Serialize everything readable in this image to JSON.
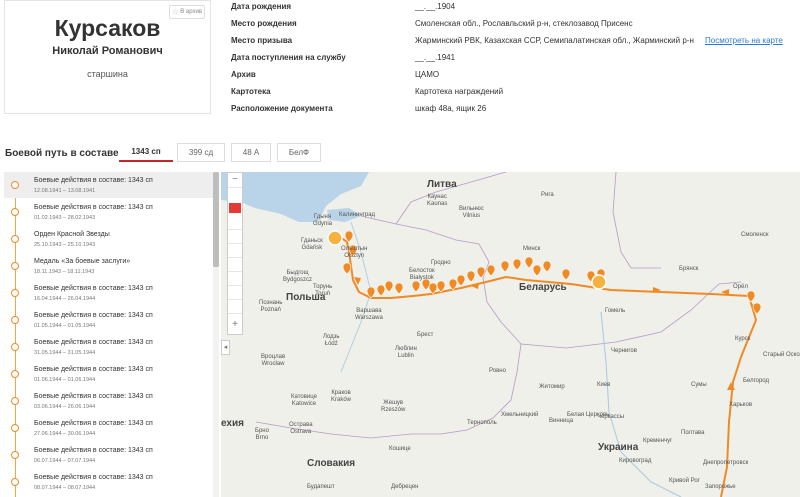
{
  "profile": {
    "surname": "Курсаков",
    "name": "Николай Романович",
    "rank": "старшина",
    "archive_badge": "В архив"
  },
  "info": [
    {
      "label": "Дата рождения",
      "value": "__.__.1904"
    },
    {
      "label": "Место рождения",
      "value": "Смоленская обл., Рославльский р-н, стеклозавод Присенс"
    },
    {
      "label": "Место призыва",
      "value": "Жарминский РВК, Казахская ССР, Семипалатинская обл., Жарминский р-н",
      "link": "Посмотреть на карте"
    },
    {
      "label": "Дата поступления на службу",
      "value": "__.__.1941"
    },
    {
      "label": "Архив",
      "value": "ЦАМО"
    },
    {
      "label": "Картотека",
      "value": "Картотека награждений"
    },
    {
      "label": "Расположение документа",
      "value": "шкаф 48а, ящик 26"
    }
  ],
  "path": {
    "title": "Боевой путь в составе:",
    "tabs": [
      "1343 сп",
      "399 сд",
      "48 А",
      "БелФ"
    ],
    "active_tab": 0
  },
  "timeline": [
    {
      "title": "Боевые действия в составе: 1343 сп",
      "date": "12.08.1941 – 13.08.1941"
    },
    {
      "title": "Боевые действия в составе: 1343 сп",
      "date": "01.02.1943 – 28.02.1943"
    },
    {
      "title": "Орден Красной Звезды",
      "date": "25.10.1943 – 25.10.1943"
    },
    {
      "title": "Медаль «За боевые заслуги»",
      "date": "18.11.1943 – 18.11.1943"
    },
    {
      "title": "Боевые действия в составе: 1343 сп",
      "date": "16.04.1944 – 26.04.1944"
    },
    {
      "title": "Боевые действия в составе: 1343 сп",
      "date": "01.05.1944 – 01.05.1944"
    },
    {
      "title": "Боевые действия в составе: 1343 сп",
      "date": "31.05.1944 – 31.05.1944"
    },
    {
      "title": "Боевые действия в составе: 1343 сп",
      "date": "01.06.1944 – 01.06.1944"
    },
    {
      "title": "Боевые действия в составе: 1343 сп",
      "date": "03.06.1944 – 26.06.1944"
    },
    {
      "title": "Боевые действия в составе: 1343 сп",
      "date": "27.06.1944 – 30.06.1944"
    },
    {
      "title": "Боевые действия в составе: 1343 сп",
      "date": "06.07.1944 – 07.07.1944"
    },
    {
      "title": "Боевые действия в составе: 1343 сп",
      "date": "08.07.1944 – 08.07.1944"
    }
  ],
  "map": {
    "route_color": "#f08a24",
    "zoom_in": "+",
    "zoom_out": "−",
    "collapse": "◂",
    "labels": [
      {
        "text": "Литва",
        "kind": "country"
      },
      {
        "text": "Польша",
        "kind": "country"
      },
      {
        "text": "Беларусь",
        "kind": "country"
      },
      {
        "text": "Украина",
        "kind": "country"
      },
      {
        "text": "Словакия",
        "kind": "country"
      },
      {
        "text": "ехия",
        "kind": "country"
      },
      {
        "text": "Гдыня\nGdynia",
        "kind": "city"
      },
      {
        "text": "Гданьск\nGdańsk",
        "kind": "city"
      },
      {
        "text": "Калининград",
        "kind": "city"
      },
      {
        "text": "Ольштын\nOlsztyn",
        "kind": "city"
      },
      {
        "text": "Быдгощ\nBydgoszcz",
        "kind": "city"
      },
      {
        "text": "Торунь\nToruń",
        "kind": "city"
      },
      {
        "text": "Познань\nPoznań",
        "kind": "city"
      },
      {
        "text": "Варшава\nWarszawa",
        "kind": "city"
      },
      {
        "text": "Лодзь\nŁódź",
        "kind": "city"
      },
      {
        "text": "Вроцлав\nWrocław",
        "kind": "city"
      },
      {
        "text": "Катовице\nKatowice",
        "kind": "city"
      },
      {
        "text": "Краков\nKraków",
        "kind": "city"
      },
      {
        "text": "Жешув\nRzeszów",
        "kind": "city"
      },
      {
        "text": "Люблин\nLublin",
        "kind": "city"
      },
      {
        "text": "Брно\nBrno",
        "kind": "city"
      },
      {
        "text": "Острава\nOstrava",
        "kind": "city"
      },
      {
        "text": "Кошице",
        "kind": "city"
      },
      {
        "text": "Будапешт",
        "kind": "city"
      },
      {
        "text": "Дебрецен",
        "kind": "city"
      },
      {
        "text": "Каунас\nKaunas",
        "kind": "city"
      },
      {
        "text": "Вильнюс\nVilnius",
        "kind": "city"
      },
      {
        "text": "Гродно",
        "kind": "city"
      },
      {
        "text": "Белосток\nBiałystok",
        "kind": "city"
      },
      {
        "text": "Минск",
        "kind": "city"
      },
      {
        "text": "Брест",
        "kind": "city"
      },
      {
        "text": "Гомель",
        "kind": "city"
      },
      {
        "text": "Чернигов",
        "kind": "city"
      },
      {
        "text": "Ровно",
        "kind": "city"
      },
      {
        "text": "Житомир",
        "kind": "city"
      },
      {
        "text": "Киев",
        "kind": "city"
      },
      {
        "text": "Тернополь",
        "kind": "city"
      },
      {
        "text": "Хмельницкий",
        "kind": "city"
      },
      {
        "text": "Винница",
        "kind": "city"
      },
      {
        "text": "Черкассы",
        "kind": "city"
      },
      {
        "text": "Белая Церковь",
        "kind": "city"
      },
      {
        "text": "Кременчуг",
        "kind": "city"
      },
      {
        "text": "Кировоград",
        "kind": "city"
      },
      {
        "text": "Кривой Рог",
        "kind": "city"
      },
      {
        "text": "Днепропетровск",
        "kind": "city"
      },
      {
        "text": "Запорожье",
        "kind": "city"
      },
      {
        "text": "Полтава",
        "kind": "city"
      },
      {
        "text": "Харьков",
        "kind": "city"
      },
      {
        "text": "Белгород",
        "kind": "city"
      },
      {
        "text": "Курск",
        "kind": "city"
      },
      {
        "text": "Орёл",
        "kind": "city"
      },
      {
        "text": "Брянск",
        "kind": "city"
      },
      {
        "text": "Сумы",
        "kind": "city"
      },
      {
        "text": "Старый Оскол",
        "kind": "city"
      },
      {
        "text": "Рига",
        "kind": "city"
      },
      {
        "text": "Смоленск",
        "kind": "city"
      }
    ]
  }
}
